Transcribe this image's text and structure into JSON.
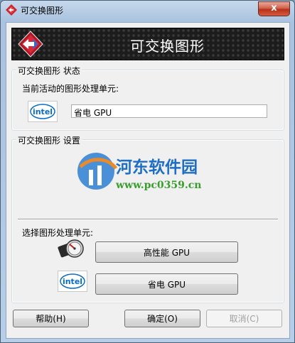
{
  "window": {
    "title": "可交换图形",
    "close_glyph": "x"
  },
  "banner": {
    "title": "可交换图形"
  },
  "status_group": {
    "legend": "可交换图形 状态",
    "current_label": "当前活动的图形处理单元:",
    "current_value": "省电 GPU",
    "logo_text": "intel"
  },
  "settings_group": {
    "legend": "可交换图形 设置",
    "select_label": "选择图形处理单元:",
    "high_perf_button": "高性能 GPU",
    "power_saving_button": "省电 GPU",
    "logo_text": "intel"
  },
  "watermark": {
    "name": "河东软件园",
    "url": "www.pc0359.cn"
  },
  "footer": {
    "help_button": "帮助(H)",
    "ok_button": "确定(O)",
    "cancel_button": "取消(C)"
  },
  "colors": {
    "watermark_blue": "#1e6fc4",
    "watermark_green": "#3a9e2e"
  }
}
